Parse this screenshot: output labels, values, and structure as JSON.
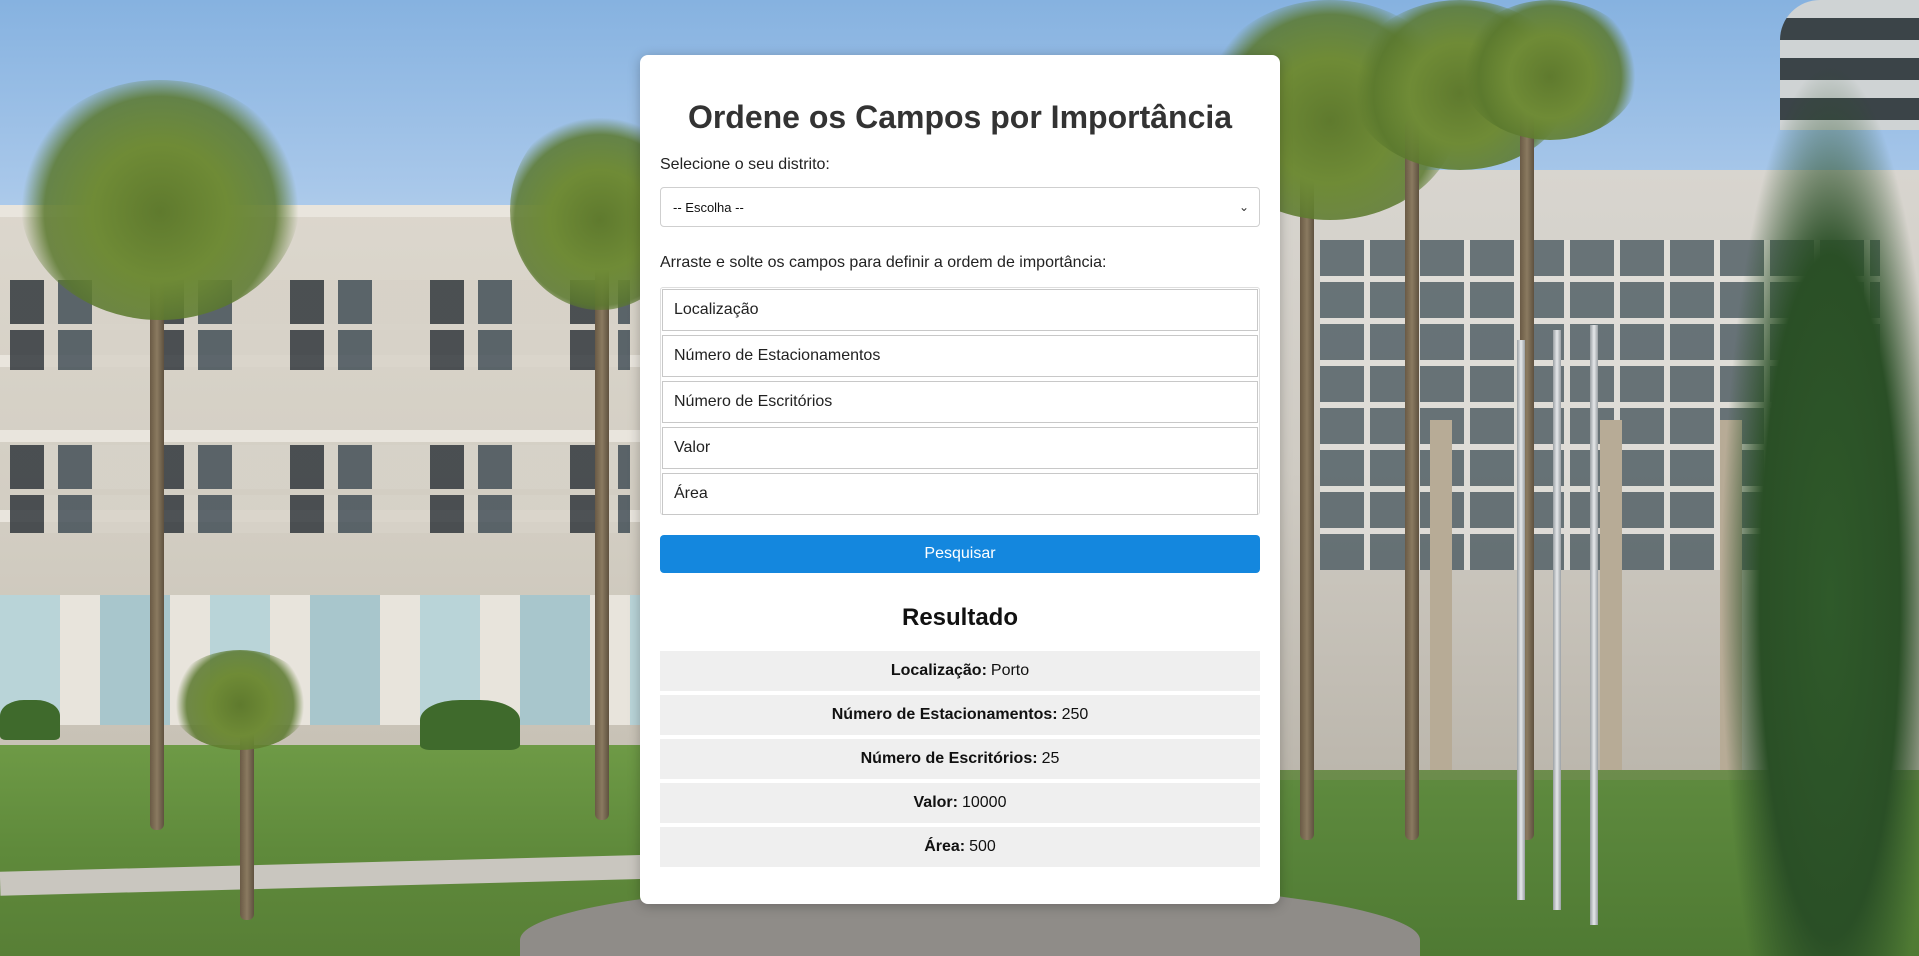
{
  "page": {
    "title": "Ordene os Campos por Importância",
    "district_label": "Selecione o seu distrito:",
    "district_select": {
      "selected": "-- Escolha --"
    },
    "drag_instruction": "Arraste e solte os campos para definir a ordem de importância:",
    "fields": [
      {
        "label": "Localização"
      },
      {
        "label": "Número de Estacionamentos"
      },
      {
        "label": "Número de Escritórios"
      },
      {
        "label": "Valor"
      },
      {
        "label": "Área"
      }
    ],
    "search_button": "Pesquisar",
    "result_title": "Resultado",
    "results": [
      {
        "key": "Localização:",
        "value": "Porto"
      },
      {
        "key": "Número de Estacionamentos:",
        "value": "250"
      },
      {
        "key": "Número de Escritórios:",
        "value": "25"
      },
      {
        "key": "Valor:",
        "value": "10000"
      },
      {
        "key": "Área:",
        "value": "500"
      }
    ]
  },
  "colors": {
    "primary_button": "#1487de",
    "result_row_bg": "#efefef"
  }
}
